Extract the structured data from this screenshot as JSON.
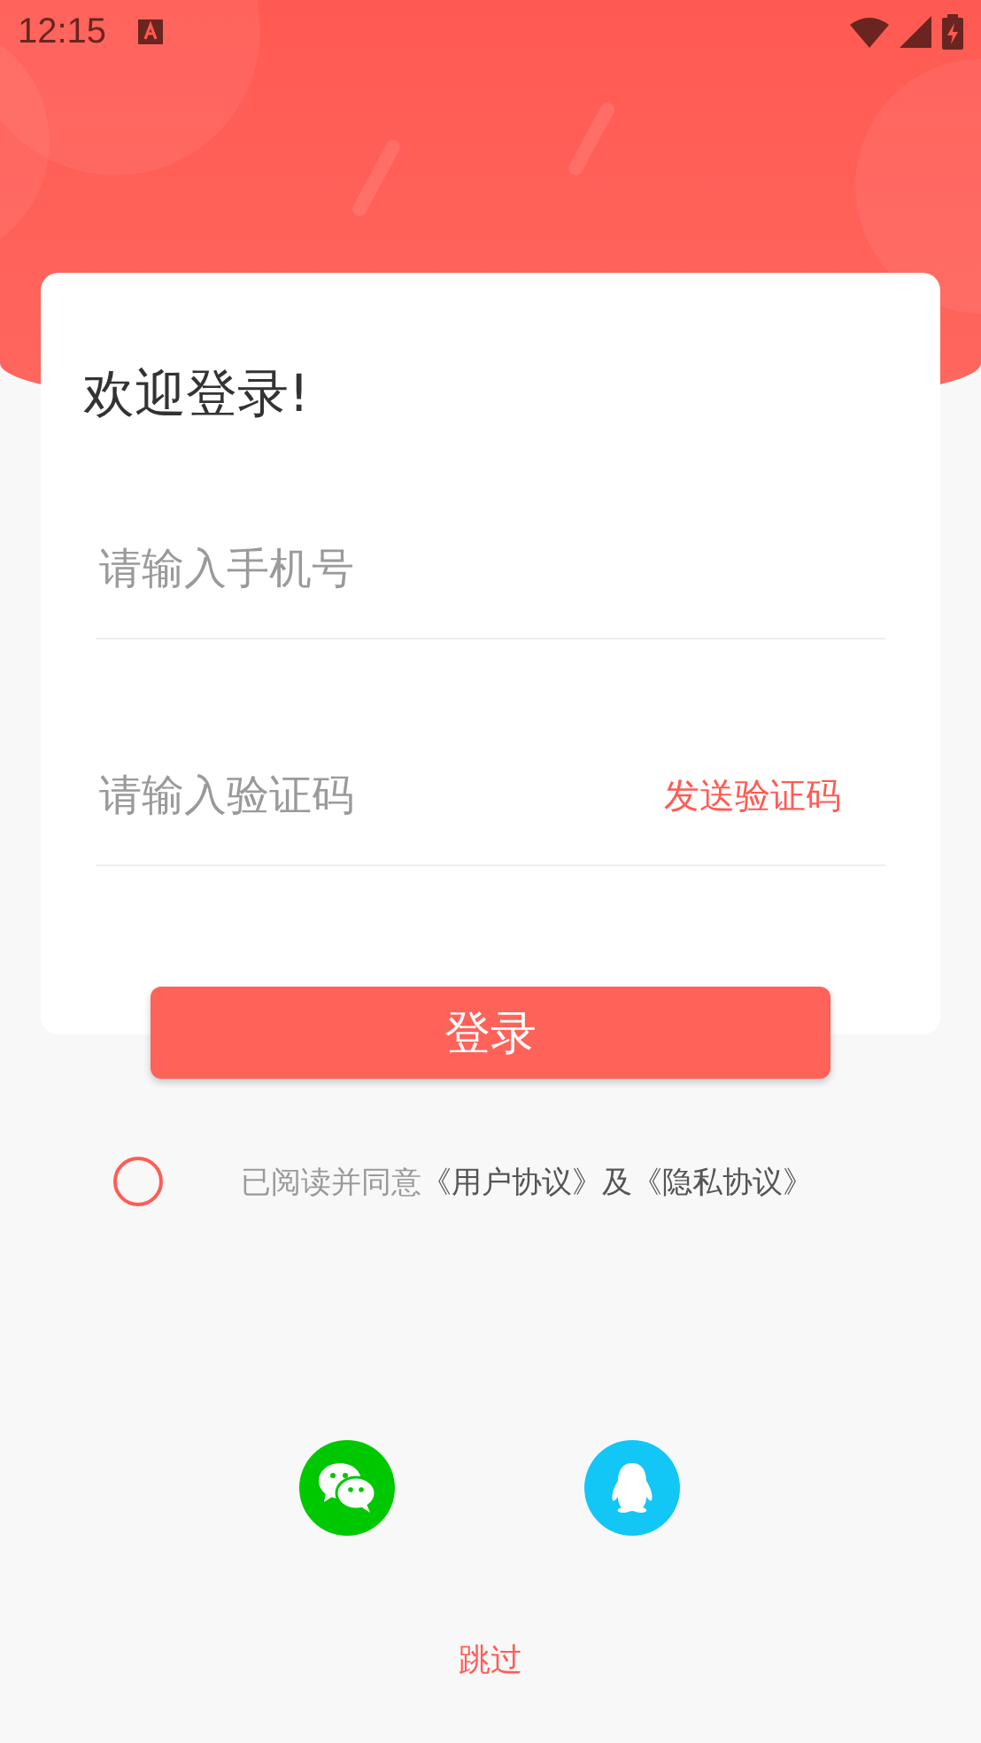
{
  "status_bar": {
    "time": "12:15"
  },
  "card": {
    "title": "欢迎登录!",
    "phone_field": {
      "placeholder": "请输入手机号"
    },
    "code_field": {
      "placeholder": "请输入验证码",
      "send_button": "发送验证码"
    }
  },
  "login_button": "登录",
  "agreement": {
    "checked": false,
    "parts": [
      {
        "kind": "text",
        "text": "已阅读并同意"
      },
      {
        "kind": "link",
        "text": "《用户协议》"
      },
      {
        "kind": "text",
        "text": "及"
      },
      {
        "kind": "link",
        "text": "《隐私协议》"
      }
    ]
  },
  "social_logins": [
    {
      "kind": "wechat"
    },
    {
      "kind": "qq"
    }
  ],
  "skip_link": "跳过"
}
